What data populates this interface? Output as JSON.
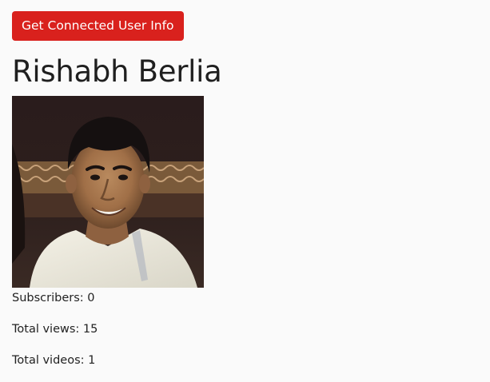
{
  "button": {
    "label": "Get Connected User Info",
    "color": "#d9211d"
  },
  "user": {
    "name": "Rishabh Berlia",
    "avatar_description": "profile-photo"
  },
  "stats": {
    "subscribers": "Subscribers: 0",
    "total_views": "Total views: 15",
    "total_videos": "Total videos: 1"
  }
}
